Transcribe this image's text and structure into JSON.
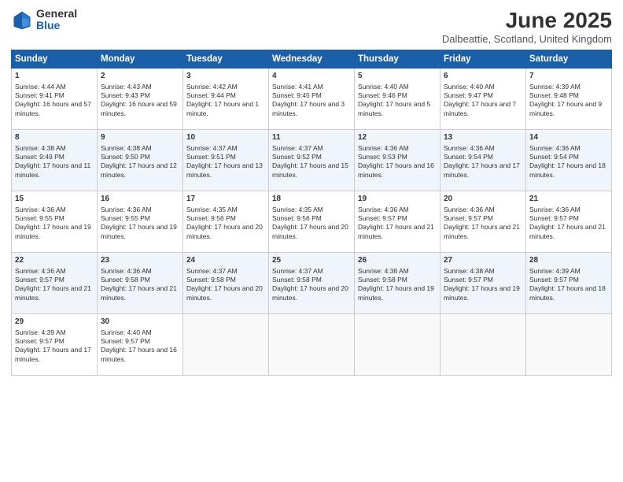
{
  "logo": {
    "general": "General",
    "blue": "Blue"
  },
  "header": {
    "month": "June 2025",
    "location": "Dalbeattie, Scotland, United Kingdom"
  },
  "days_of_week": [
    "Sunday",
    "Monday",
    "Tuesday",
    "Wednesday",
    "Thursday",
    "Friday",
    "Saturday"
  ],
  "weeks": [
    [
      {
        "day": "1",
        "sunrise": "Sunrise: 4:44 AM",
        "sunset": "Sunset: 9:41 PM",
        "daylight": "Daylight: 16 hours and 57 minutes."
      },
      {
        "day": "2",
        "sunrise": "Sunrise: 4:43 AM",
        "sunset": "Sunset: 9:43 PM",
        "daylight": "Daylight: 16 hours and 59 minutes."
      },
      {
        "day": "3",
        "sunrise": "Sunrise: 4:42 AM",
        "sunset": "Sunset: 9:44 PM",
        "daylight": "Daylight: 17 hours and 1 minute."
      },
      {
        "day": "4",
        "sunrise": "Sunrise: 4:41 AM",
        "sunset": "Sunset: 9:45 PM",
        "daylight": "Daylight: 17 hours and 3 minutes."
      },
      {
        "day": "5",
        "sunrise": "Sunrise: 4:40 AM",
        "sunset": "Sunset: 9:46 PM",
        "daylight": "Daylight: 17 hours and 5 minutes."
      },
      {
        "day": "6",
        "sunrise": "Sunrise: 4:40 AM",
        "sunset": "Sunset: 9:47 PM",
        "daylight": "Daylight: 17 hours and 7 minutes."
      },
      {
        "day": "7",
        "sunrise": "Sunrise: 4:39 AM",
        "sunset": "Sunset: 9:48 PM",
        "daylight": "Daylight: 17 hours and 9 minutes."
      }
    ],
    [
      {
        "day": "8",
        "sunrise": "Sunrise: 4:38 AM",
        "sunset": "Sunset: 9:49 PM",
        "daylight": "Daylight: 17 hours and 11 minutes."
      },
      {
        "day": "9",
        "sunrise": "Sunrise: 4:38 AM",
        "sunset": "Sunset: 9:50 PM",
        "daylight": "Daylight: 17 hours and 12 minutes."
      },
      {
        "day": "10",
        "sunrise": "Sunrise: 4:37 AM",
        "sunset": "Sunset: 9:51 PM",
        "daylight": "Daylight: 17 hours and 13 minutes."
      },
      {
        "day": "11",
        "sunrise": "Sunrise: 4:37 AM",
        "sunset": "Sunset: 9:52 PM",
        "daylight": "Daylight: 17 hours and 15 minutes."
      },
      {
        "day": "12",
        "sunrise": "Sunrise: 4:36 AM",
        "sunset": "Sunset: 9:53 PM",
        "daylight": "Daylight: 17 hours and 16 minutes."
      },
      {
        "day": "13",
        "sunrise": "Sunrise: 4:36 AM",
        "sunset": "Sunset: 9:54 PM",
        "daylight": "Daylight: 17 hours and 17 minutes."
      },
      {
        "day": "14",
        "sunrise": "Sunrise: 4:36 AM",
        "sunset": "Sunset: 9:54 PM",
        "daylight": "Daylight: 17 hours and 18 minutes."
      }
    ],
    [
      {
        "day": "15",
        "sunrise": "Sunrise: 4:36 AM",
        "sunset": "Sunset: 9:55 PM",
        "daylight": "Daylight: 17 hours and 19 minutes."
      },
      {
        "day": "16",
        "sunrise": "Sunrise: 4:36 AM",
        "sunset": "Sunset: 9:55 PM",
        "daylight": "Daylight: 17 hours and 19 minutes."
      },
      {
        "day": "17",
        "sunrise": "Sunrise: 4:35 AM",
        "sunset": "Sunset: 9:56 PM",
        "daylight": "Daylight: 17 hours and 20 minutes."
      },
      {
        "day": "18",
        "sunrise": "Sunrise: 4:35 AM",
        "sunset": "Sunset: 9:56 PM",
        "daylight": "Daylight: 17 hours and 20 minutes."
      },
      {
        "day": "19",
        "sunrise": "Sunrise: 4:36 AM",
        "sunset": "Sunset: 9:57 PM",
        "daylight": "Daylight: 17 hours and 21 minutes."
      },
      {
        "day": "20",
        "sunrise": "Sunrise: 4:36 AM",
        "sunset": "Sunset: 9:57 PM",
        "daylight": "Daylight: 17 hours and 21 minutes."
      },
      {
        "day": "21",
        "sunrise": "Sunrise: 4:36 AM",
        "sunset": "Sunset: 9:57 PM",
        "daylight": "Daylight: 17 hours and 21 minutes."
      }
    ],
    [
      {
        "day": "22",
        "sunrise": "Sunrise: 4:36 AM",
        "sunset": "Sunset: 9:57 PM",
        "daylight": "Daylight: 17 hours and 21 minutes."
      },
      {
        "day": "23",
        "sunrise": "Sunrise: 4:36 AM",
        "sunset": "Sunset: 9:58 PM",
        "daylight": "Daylight: 17 hours and 21 minutes."
      },
      {
        "day": "24",
        "sunrise": "Sunrise: 4:37 AM",
        "sunset": "Sunset: 9:58 PM",
        "daylight": "Daylight: 17 hours and 20 minutes."
      },
      {
        "day": "25",
        "sunrise": "Sunrise: 4:37 AM",
        "sunset": "Sunset: 9:58 PM",
        "daylight": "Daylight: 17 hours and 20 minutes."
      },
      {
        "day": "26",
        "sunrise": "Sunrise: 4:38 AM",
        "sunset": "Sunset: 9:58 PM",
        "daylight": "Daylight: 17 hours and 19 minutes."
      },
      {
        "day": "27",
        "sunrise": "Sunrise: 4:38 AM",
        "sunset": "Sunset: 9:57 PM",
        "daylight": "Daylight: 17 hours and 19 minutes."
      },
      {
        "day": "28",
        "sunrise": "Sunrise: 4:39 AM",
        "sunset": "Sunset: 9:57 PM",
        "daylight": "Daylight: 17 hours and 18 minutes."
      }
    ],
    [
      {
        "day": "29",
        "sunrise": "Sunrise: 4:39 AM",
        "sunset": "Sunset: 9:57 PM",
        "daylight": "Daylight: 17 hours and 17 minutes."
      },
      {
        "day": "30",
        "sunrise": "Sunrise: 4:40 AM",
        "sunset": "Sunset: 9:57 PM",
        "daylight": "Daylight: 17 hours and 16 minutes."
      },
      null,
      null,
      null,
      null,
      null
    ]
  ]
}
